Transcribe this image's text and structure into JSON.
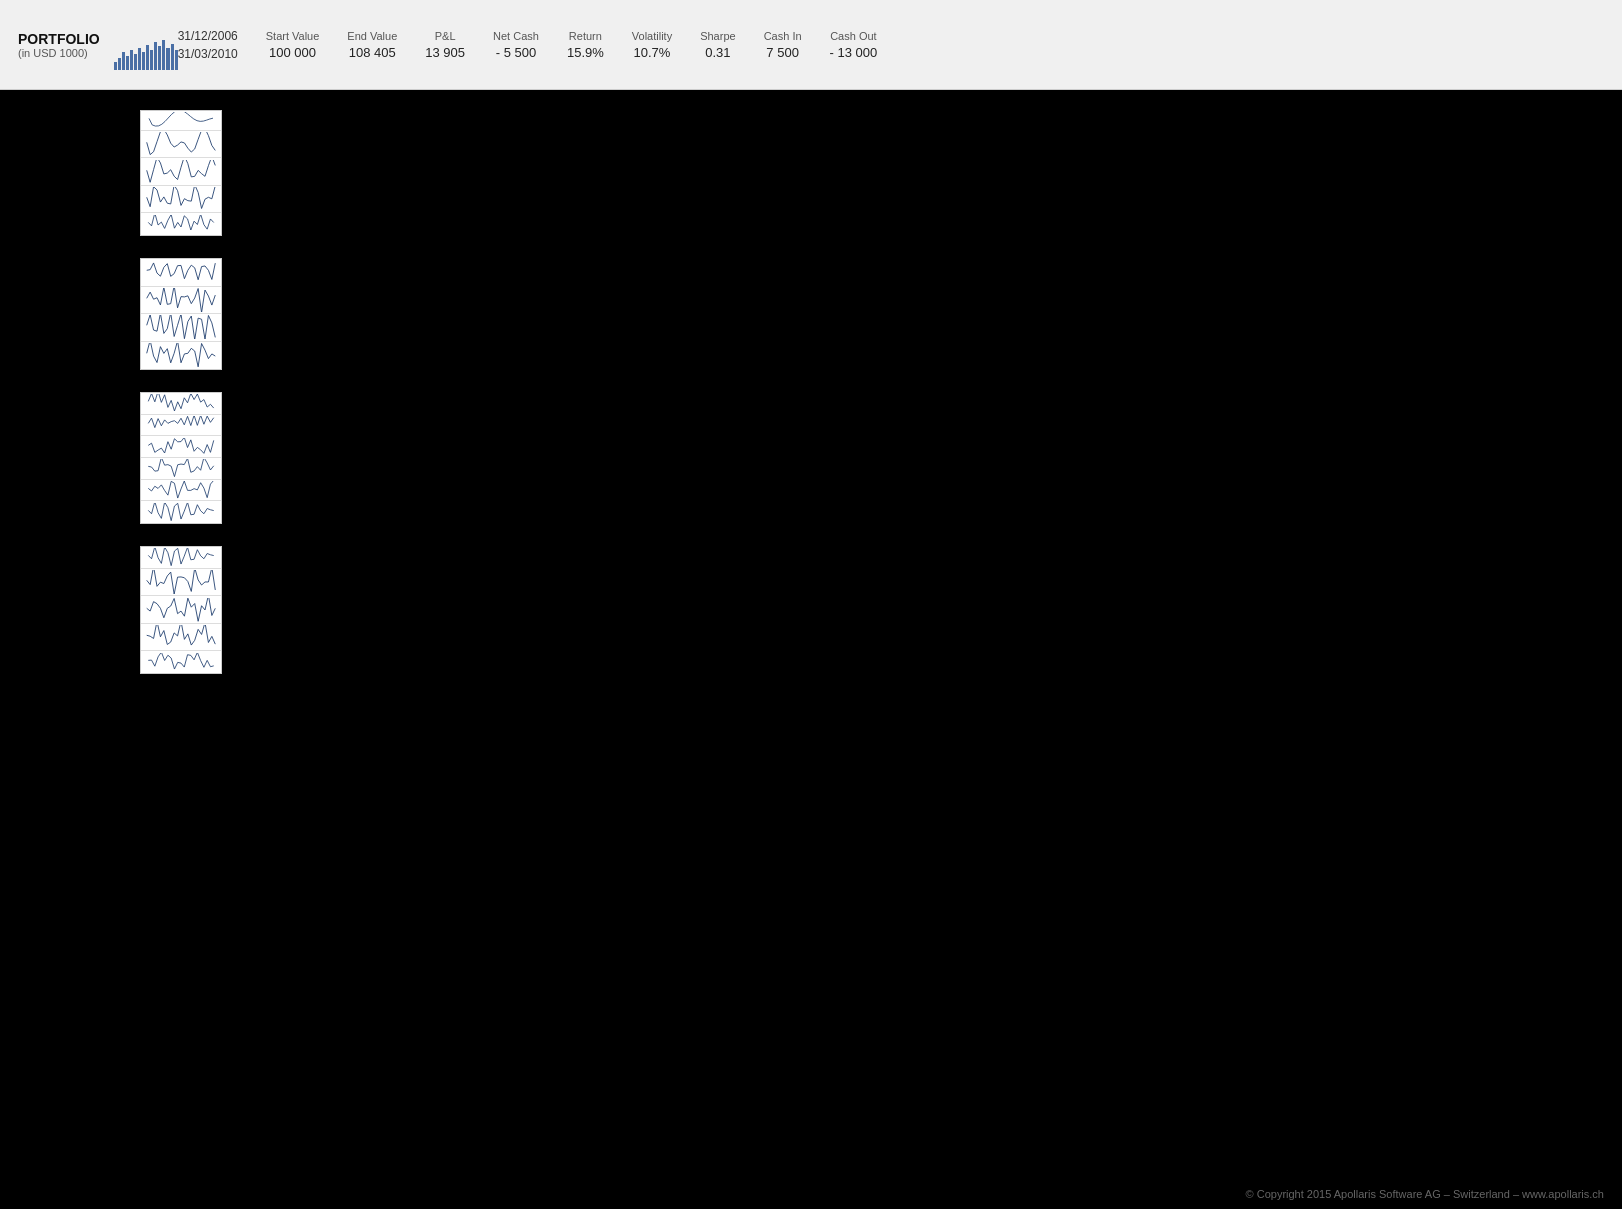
{
  "header": {
    "portfolio_label": "PORTFOLIO",
    "portfolio_sub": "(in USD 1000)",
    "date_start": "31/12/2006",
    "date_end": "31/03/2010",
    "stats": [
      {
        "label": "Start Value",
        "value": "100 000"
      },
      {
        "label": "End Value",
        "value": "108 405"
      },
      {
        "label": "P&L",
        "value": "13 905"
      },
      {
        "label": "Net Cash",
        "value": "- 5 500"
      },
      {
        "label": "Return",
        "value": "15.9%"
      },
      {
        "label": "Volatility",
        "value": "10.7%"
      },
      {
        "label": "Sharpe",
        "value": "0.31"
      },
      {
        "label": "Cash In",
        "value": "7 500"
      },
      {
        "label": "Cash Out",
        "value": "- 13 000"
      }
    ]
  },
  "footer": {
    "text": "© Copyright 2015 Apollaris Software AG – Switzerland – www.apollaris.ch"
  },
  "charts": [
    {
      "id": "chart-1",
      "rows": 5
    },
    {
      "id": "chart-2",
      "rows": 4
    },
    {
      "id": "chart-3",
      "rows": 6
    },
    {
      "id": "chart-4",
      "rows": 5
    }
  ],
  "bar_heights": [
    8,
    12,
    18,
    14,
    20,
    16,
    22,
    18,
    25,
    20,
    28,
    24,
    30,
    22,
    26,
    20
  ]
}
